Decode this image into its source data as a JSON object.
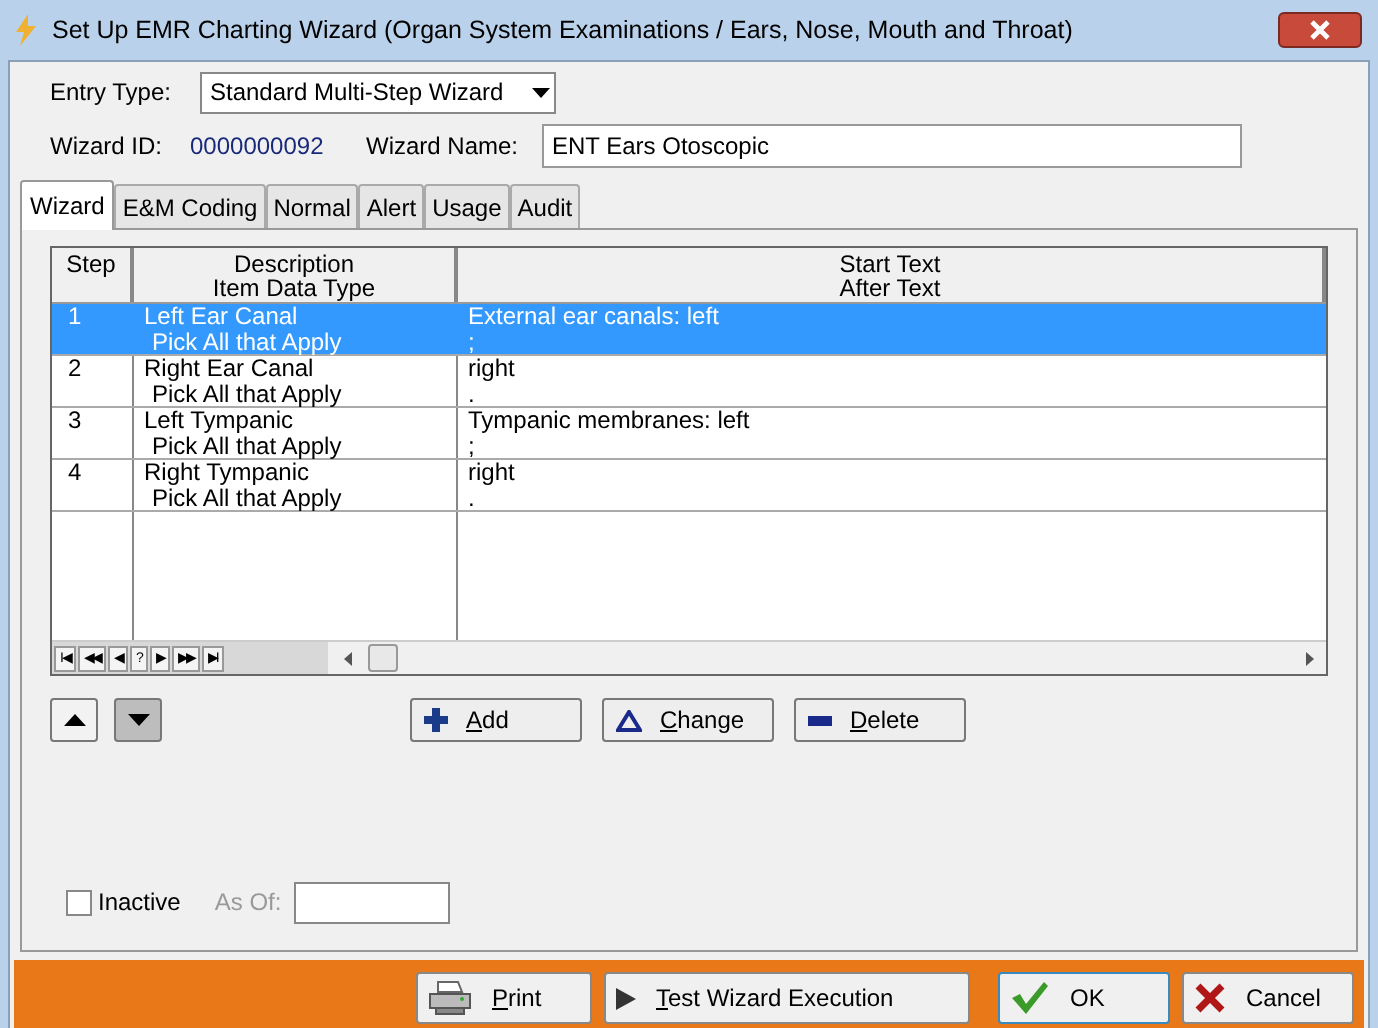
{
  "window": {
    "title": "Set Up EMR Charting Wizard (Organ System Examinations / Ears, Nose, Mouth and Throat)"
  },
  "entry_type": {
    "label": "Entry Type:",
    "value": "Standard Multi-Step Wizard"
  },
  "wizard_id": {
    "label": "Wizard ID:",
    "value": "0000000092"
  },
  "wizard_name": {
    "label": "Wizard Name:",
    "value": "ENT Ears Otoscopic"
  },
  "tabs": [
    {
      "label": "Wizard",
      "selected": true
    },
    {
      "label": "E&M Coding",
      "selected": false
    },
    {
      "label": "Normal",
      "selected": false
    },
    {
      "label": "Alert",
      "selected": false
    },
    {
      "label": "Usage",
      "selected": false
    },
    {
      "label": "Audit",
      "selected": false
    }
  ],
  "table": {
    "columns": [
      {
        "line1": "Step"
      },
      {
        "line1": "Description",
        "line2": "Item Data Type"
      },
      {
        "line1": "Start Text",
        "line2": "After Text"
      }
    ],
    "rows": [
      {
        "step": "1",
        "description": "Left Ear Canal",
        "item_type": "Pick All that Apply",
        "start_text": "External ear canals:  left",
        "after_text": ";",
        "selected": true
      },
      {
        "step": "2",
        "description": "Right Ear Canal",
        "item_type": "Pick All that Apply",
        "start_text": "right",
        "after_text": ".",
        "selected": false
      },
      {
        "step": "3",
        "description": "Left Tympanic",
        "item_type": "Pick All that Apply",
        "start_text": "Tympanic membranes:  left",
        "after_text": ";",
        "selected": false
      },
      {
        "step": "4",
        "description": "Right Tympanic",
        "item_type": "Pick All that Apply",
        "start_text": "right",
        "after_text": ".",
        "selected": false
      }
    ],
    "navigator": [
      "I◀",
      "◀◀",
      "◀",
      "?",
      "▶",
      "▶▶",
      "▶I"
    ]
  },
  "edit_buttons": [
    {
      "label": "Add",
      "kind": "add",
      "accelerator": true
    },
    {
      "label": "Change",
      "kind": "change",
      "accelerator": true
    },
    {
      "label": "Delete",
      "kind": "delete",
      "accelerator": true
    }
  ],
  "inactive": {
    "label": "Inactive",
    "checked": false
  },
  "as_of": {
    "label": "As Of:"
  },
  "footer_buttons": [
    {
      "label": "Print",
      "kind": "print",
      "accelerator": true
    },
    {
      "label": "Test Wizard Execution",
      "kind": "test",
      "accelerator": true
    },
    {
      "label": "OK",
      "kind": "ok",
      "accelerator": false
    },
    {
      "label": "Cancel",
      "kind": "cancel",
      "accelerator": false
    }
  ]
}
